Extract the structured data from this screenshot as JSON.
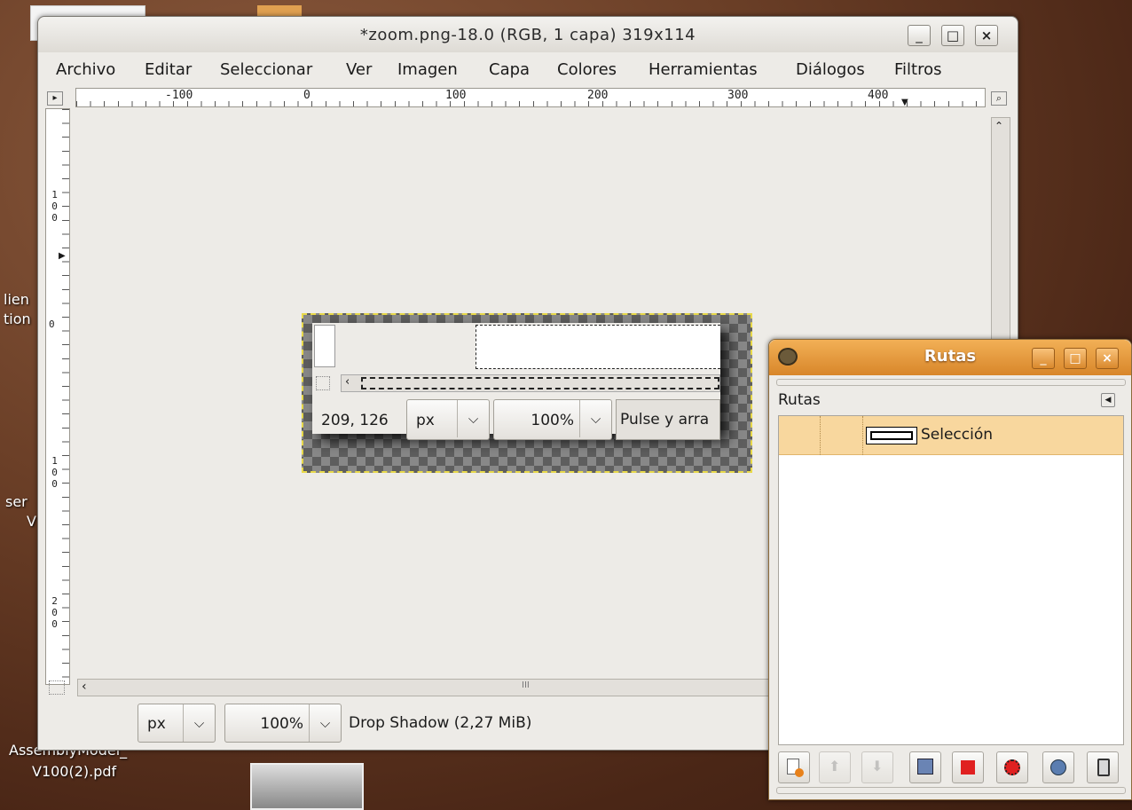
{
  "desktop": {
    "icon_labels": [
      "lien",
      "tion",
      "ser",
      "V",
      "AssemblyModel_",
      "V100(2).pdf"
    ]
  },
  "window": {
    "title": "*zoom.png-18.0 (RGB, 1 capa) 319x114",
    "controls": {
      "minimize": "_",
      "maximize": "□",
      "close": "×"
    }
  },
  "menubar": [
    "Archivo",
    "Editar",
    "Seleccionar",
    "Ver",
    "Imagen",
    "Capa",
    "Colores",
    "Herramientas",
    "Diálogos",
    "Filtros"
  ],
  "rulers": {
    "horizontal": [
      "-100",
      "0",
      "100",
      "200",
      "300",
      "400"
    ],
    "vertical": [
      "100",
      "0",
      "100",
      "200"
    ]
  },
  "statusbar": {
    "unit": "px",
    "zoom": "100%",
    "message": "Drop Shadow (2,27 MiB)",
    "scroll_mark": "III"
  },
  "image_content": {
    "coords": "209, 126",
    "unit": "px",
    "zoom": "100%",
    "hint": "Pulse y arra"
  },
  "dock": {
    "title": "Rutas",
    "tab_label": "Rutas",
    "paths": [
      {
        "name": "Selección"
      }
    ]
  },
  "colors": {
    "accent": "#d8862a",
    "selected_row": "#f8d79e"
  }
}
